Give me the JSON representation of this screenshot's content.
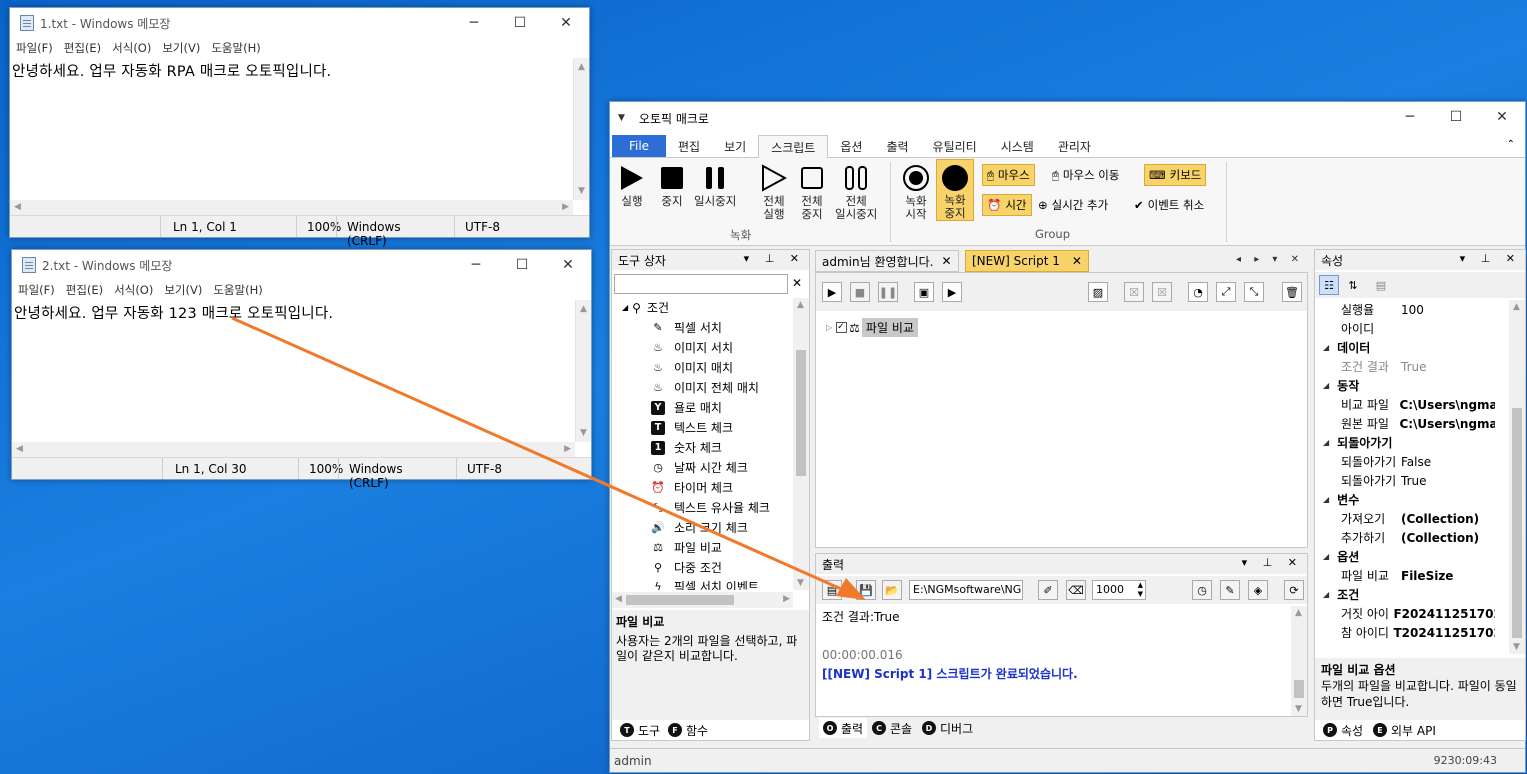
{
  "notepad1": {
    "title": "1.txt - Windows 메모장",
    "menu": [
      "파일(F)",
      "편집(E)",
      "서식(O)",
      "보기(V)",
      "도움말(H)"
    ],
    "content": "안녕하세요. 업무 자동화 RPA 매크로 오토픽입니다.",
    "status": {
      "pos": "Ln 1, Col 1",
      "zoom": "100%",
      "eol": "Windows (CRLF)",
      "enc": "UTF-8"
    }
  },
  "notepad2": {
    "title": "2.txt - Windows 메모장",
    "menu": [
      "파일(F)",
      "편집(E)",
      "서식(O)",
      "보기(V)",
      "도움말(H)"
    ],
    "content": "안녕하세요. 업무 자동화 123 매크로 오토픽입니다.",
    "status": {
      "pos": "Ln 1, Col 30",
      "zoom": "100%",
      "eol": "Windows (CRLF)",
      "enc": "UTF-8"
    }
  },
  "app": {
    "title": "오토픽 매크로",
    "tabs": [
      "File",
      "편집",
      "보기",
      "스크립트",
      "옵션",
      "출력",
      "유틸리티",
      "시스템",
      "관리자"
    ],
    "ribbon": {
      "run": "실행",
      "stop": "중지",
      "pause": "일시중지",
      "all_run": "전체\n실행",
      "all_stop": "전체\n중지",
      "all_pause": "전체\n일시중지",
      "rec_start": "녹화\n시작",
      "rec_stop": "녹화\n중지",
      "group_rec": "녹화",
      "mouse": "마우스",
      "mouse_move": "마우스 이동",
      "keyboard": "키보드",
      "time": "시간",
      "realtime_add": "실시간 추가",
      "event_cancel": "이벤트 취소",
      "group_group": "Group"
    },
    "toolbox": {
      "title": "도구 상자",
      "root": "조건",
      "items": [
        "픽셀 서치",
        "이미지 서치",
        "이미지 매치",
        "이미지 전체 매치",
        "욜로 매치",
        "텍스트 체크",
        "숫자 체크",
        "날짜 시간 체크",
        "타이머 체크",
        "텍스트 유사율 체크",
        "소리 크기 체크",
        "파일 비교",
        "다중 조건",
        "픽셀 서치 이벤트"
      ],
      "desc_title": "파일 비교",
      "desc": "사용자는 2개의 파일을 선택하고, 파일이 같은지 비교합니다.",
      "tab_tool": "도구",
      "tab_func": "함수"
    },
    "doc": {
      "tab1": "admin님 환영합니다.",
      "tab2": "[NEW] Script 1",
      "node": "파일 비교"
    },
    "output": {
      "title": "출력",
      "path": "E:\\NGMsoftware\\NG",
      "num": "1000",
      "line1": "조건 결과:True",
      "line2": "00:00:00.016",
      "line3": "[[NEW] Script 1] 스크립트가 완료되었습니다.",
      "tab_out": "출력",
      "tab_console": "콘솔",
      "tab_debug": "디버그"
    },
    "props": {
      "title": "속성",
      "rows": [
        {
          "type": "row",
          "k": "실행율",
          "v": "100"
        },
        {
          "type": "row",
          "k": "아이디",
          "v": ""
        },
        {
          "type": "cat",
          "k": "데이터"
        },
        {
          "type": "row",
          "k": "조건 결과",
          "v": "True",
          "dim": true
        },
        {
          "type": "cat",
          "k": "동작"
        },
        {
          "type": "row",
          "k": "비교 파일",
          "v": "C:\\Users\\ngma",
          "b": true
        },
        {
          "type": "row",
          "k": "원본 파일",
          "v": "C:\\Users\\ngma",
          "b": true
        },
        {
          "type": "cat",
          "k": "되돌아가기"
        },
        {
          "type": "row",
          "k": "되돌아가기",
          "v": "False"
        },
        {
          "type": "row",
          "k": "되돌아가기",
          "v": "True"
        },
        {
          "type": "cat",
          "k": "변수"
        },
        {
          "type": "row",
          "k": "가져오기",
          "v": "(Collection)",
          "b": true
        },
        {
          "type": "row",
          "k": "추가하기",
          "v": "(Collection)",
          "b": true
        },
        {
          "type": "cat",
          "k": "옵션"
        },
        {
          "type": "row",
          "k": "파일 비교",
          "v": "FileSize",
          "b": true
        },
        {
          "type": "cat",
          "k": "조건"
        },
        {
          "type": "row",
          "k": "거짓 아이",
          "v": "F2024112517021",
          "b": true
        },
        {
          "type": "row",
          "k": "참 아이디",
          "v": "T2024112517021",
          "b": true
        }
      ],
      "desc_title": "파일 비교 옵션",
      "desc": "두개의 파일을 비교합니다. 파일이 동일하면 True입니다.",
      "tab_prop": "속성",
      "tab_api": "외부 API"
    },
    "status": {
      "user": "admin",
      "time": "9230:09:43"
    }
  },
  "colors": {
    "accent": "#2d6ed6",
    "highlight": "#f8d36a",
    "arrow": "#f07a2a",
    "link": "#1a32c8"
  }
}
